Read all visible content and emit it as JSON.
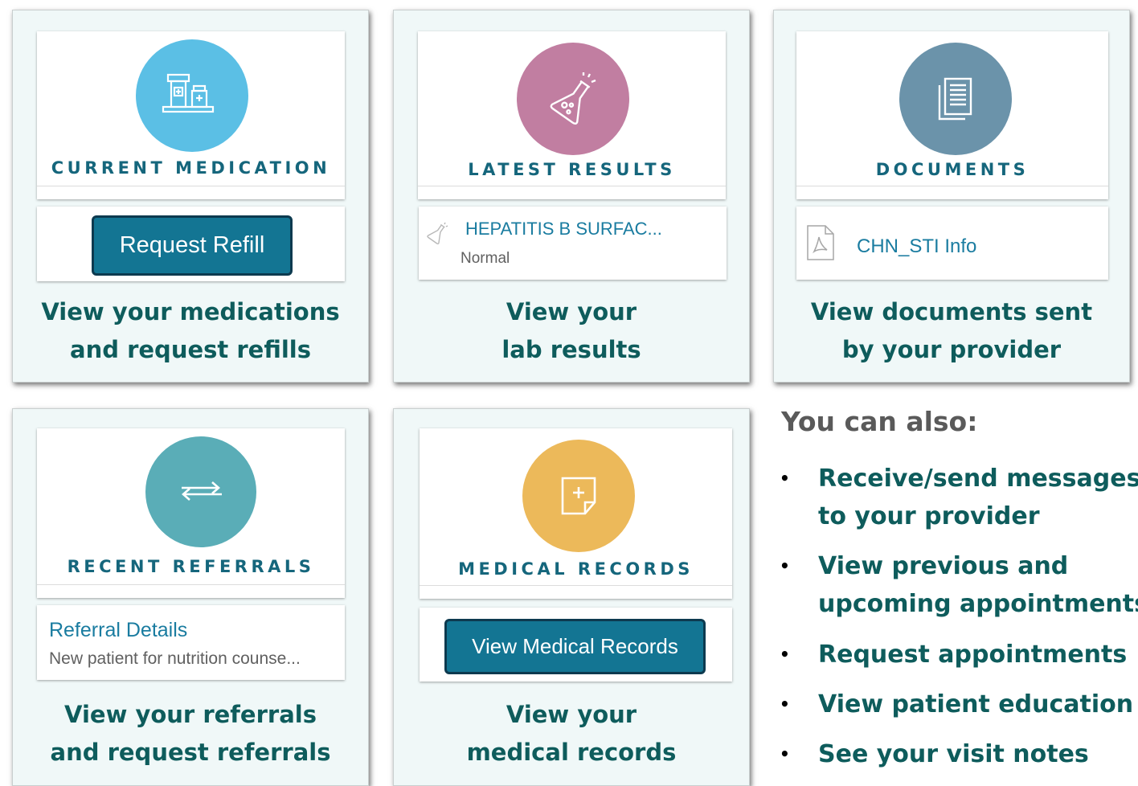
{
  "tiles": {
    "medication": {
      "title": "CURRENT MEDICATION",
      "button": "Request Refill",
      "caption_line1": "View your medications",
      "caption_line2": "and request refills",
      "color": "#5bbfe5"
    },
    "results": {
      "title": "LATEST RESULTS",
      "item_title": "HEPATITIS B SURFAC...",
      "item_status": "Normal",
      "caption_line1": "View your",
      "caption_line2": "lab results",
      "color": "#c17ea1"
    },
    "documents": {
      "title": "DOCUMENTS",
      "item_title": "CHN_STI Info",
      "caption_line1": "View documents sent",
      "caption_line2": "by your provider",
      "color": "#6b93aa"
    },
    "referrals": {
      "title": "RECENT REFERRALS",
      "item_title": "Referral Details",
      "item_desc": "New patient for nutrition counse...",
      "caption_line1": "View your referrals",
      "caption_line2": "and request referrals",
      "color": "#5aadb7"
    },
    "records": {
      "title": "MEDICAL RECORDS",
      "button": "View Medical Records",
      "caption_line1": "View your",
      "caption_line2": "medical records",
      "color": "#ecb95a"
    }
  },
  "also": {
    "title": "You can also:",
    "items": [
      {
        "line1": "Receive/send messages",
        "line2": "to your provider"
      },
      {
        "line1": "View previous and",
        "line2": "upcoming appointments"
      },
      {
        "line1": "Request appointments",
        "line2": ""
      },
      {
        "line1": "View patient education",
        "line2": ""
      },
      {
        "line1": "See your visit notes",
        "line2": ""
      }
    ]
  },
  "icons": [
    "pharmacy-icon",
    "flask-icon",
    "documents-icon",
    "arrows-icon",
    "add-note-icon",
    "pdf-file-icon",
    "flask-small-icon"
  ]
}
